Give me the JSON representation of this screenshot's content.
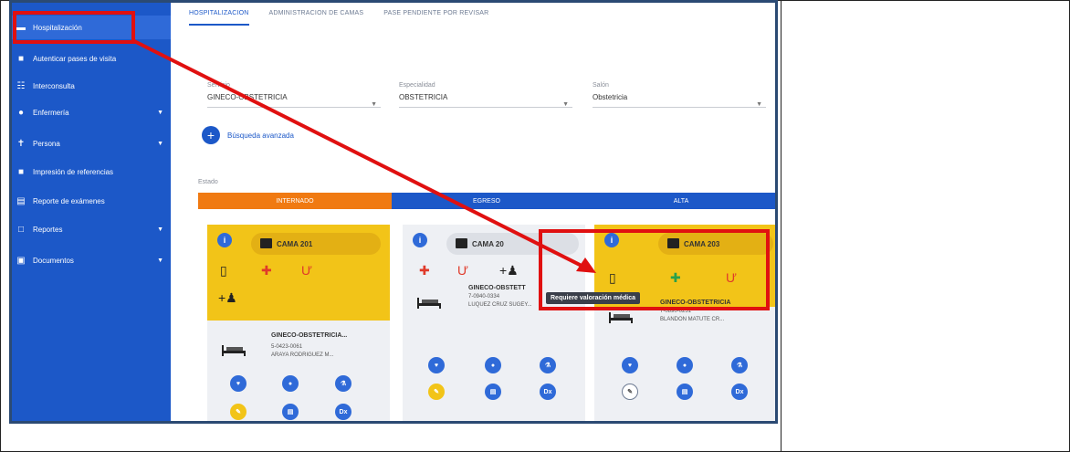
{
  "sidebar": {
    "items": [
      {
        "label": "Hospitalización",
        "icon": "chat-icon",
        "active": true
      },
      {
        "label": "Autenticar pases de visita",
        "icon": "card-icon"
      },
      {
        "label": "Interconsulta",
        "icon": "people-icon"
      },
      {
        "label": "Enfermería",
        "icon": "location-icon",
        "chevron": true
      },
      {
        "label": "Persona",
        "icon": "person-icon",
        "chevron": true
      },
      {
        "label": "Impresión de referencias",
        "icon": "printer-icon"
      },
      {
        "label": "Reporte de exámenes",
        "icon": "report-icon"
      },
      {
        "label": "Reportes",
        "icon": "document-icon",
        "chevron": true
      },
      {
        "label": "Documentos",
        "icon": "folder-icon",
        "chevron": true
      }
    ]
  },
  "tabs": [
    "HOSPITALIZACION",
    "ADMINISTRACION DE CAMAS",
    "PASE PENDIENTE POR REVISAR"
  ],
  "filters": {
    "servicio": {
      "label": "Servicio",
      "value": "GINECO-OBSTETRICIA"
    },
    "especialidad": {
      "label": "Especialidad",
      "value": "OBSTETRICIA"
    },
    "salon": {
      "label": "Salón",
      "value": "Obstetricia"
    }
  },
  "advanced_search": "Búsqueda avanzada",
  "estado": {
    "label": "Estado",
    "segments": [
      {
        "label": "INTERNADO",
        "color": "#f07a12"
      },
      {
        "label": "EGRESO",
        "color": "#1c58c8"
      },
      {
        "label": "ALTA",
        "color": "#1c58c8"
      }
    ]
  },
  "cards": [
    {
      "bed": "CAMA 201",
      "service": "GINECO-OBSTETRICIA...",
      "id": "5-0423-0061",
      "name": "ARAYA RODRIGUEZ M..."
    },
    {
      "bed": "CAMA 20",
      "service": "GINECO-OBSTETT",
      "id": "7-0940-0334",
      "name": "LUQUEZ CRUZ SUGEY..."
    },
    {
      "bed": "CAMA 203",
      "service": "GINECO-OBSTETRICIA",
      "id": "7-0890-0251",
      "name": "BLANDON MATUTE CR..."
    }
  ],
  "tooltip": "Requiere valoración médica",
  "colors": {
    "sidebar": "#1c58c8",
    "highlight": "#e01010",
    "card_head": "#f2c418"
  }
}
